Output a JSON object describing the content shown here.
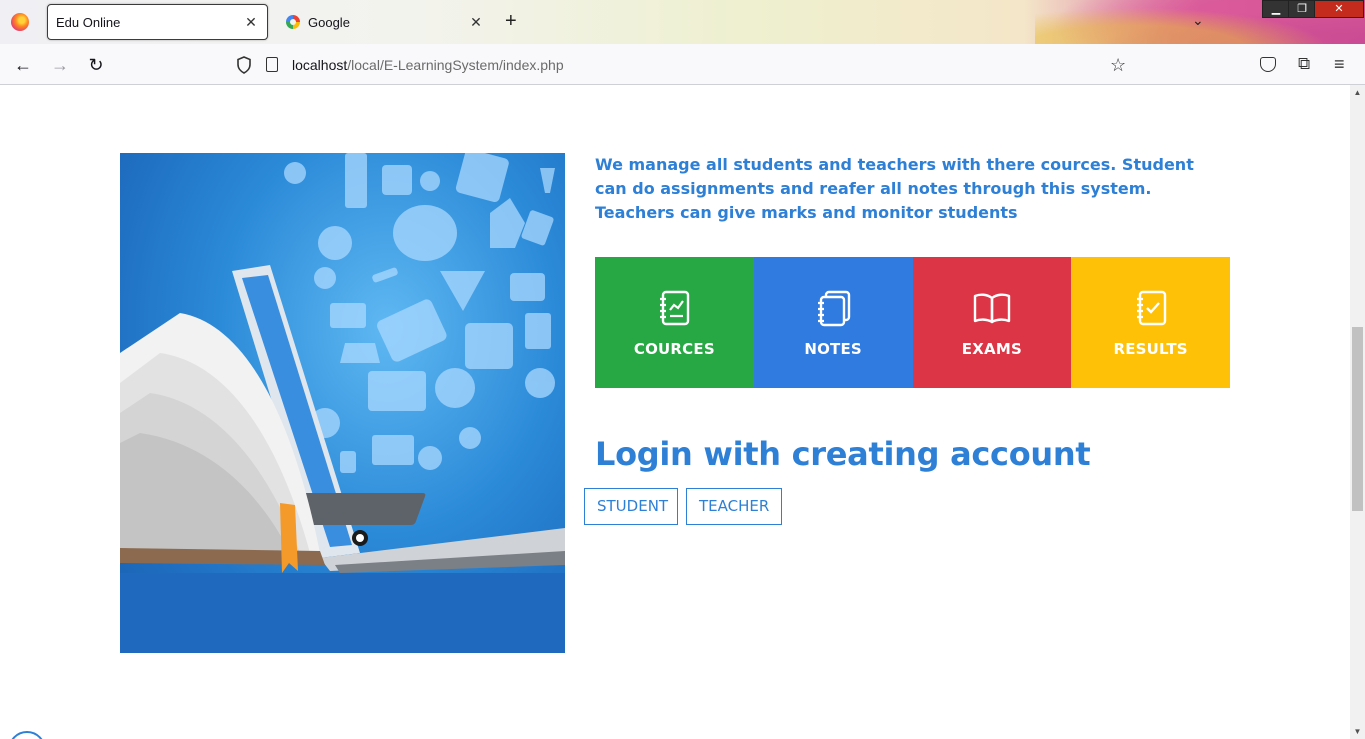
{
  "browser": {
    "tabs": [
      {
        "title": "Edu Online",
        "active": true
      },
      {
        "title": "Google",
        "active": false
      }
    ],
    "new_tab_symbol": "+",
    "url": {
      "host": "localhost",
      "path": "/local/E-LearningSystem/index.php"
    },
    "icons": {
      "back": "back-arrow-icon",
      "forward": "forward-arrow-icon",
      "reload": "reload-icon",
      "tracking": "shield-icon",
      "page": "page-icon",
      "bookmark": "star-icon",
      "pocket": "pocket-icon",
      "extensions": "puzzle-icon",
      "menu": "hamburger-menu-icon"
    }
  },
  "page": {
    "intro_text": "We manage all students and teachers with there cources. Student can do assignments and reafer all notes through this system. Teachers can give marks and monitor students",
    "tiles": [
      {
        "label": "COURCES",
        "color": "#28a745",
        "icon": "courses-notebook-icon"
      },
      {
        "label": "NOTES",
        "color": "#2f7be0",
        "icon": "notes-notebook-icon"
      },
      {
        "label": "EXAMS",
        "color": "#dc3545",
        "icon": "open-book-icon"
      },
      {
        "label": "RESULTS",
        "color": "#ffc107",
        "icon": "checklist-notebook-icon"
      }
    ],
    "login_heading": "Login with creating account",
    "login_buttons": {
      "student": "STUDENT",
      "teacher": "TEACHER"
    },
    "accent_color": "#2e7fd6"
  }
}
